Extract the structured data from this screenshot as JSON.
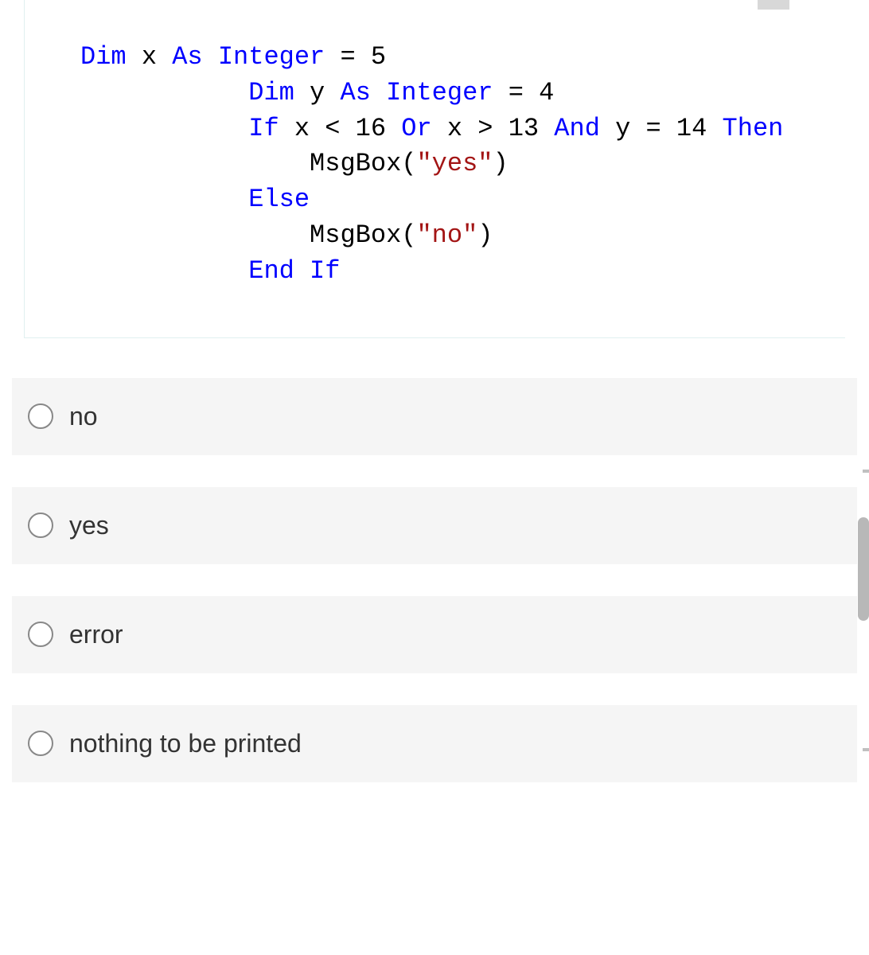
{
  "code": {
    "line1_kw1": "Dim",
    "line1_txt1": " x ",
    "line1_kw2": "As Integer",
    "line1_txt2": " = 5",
    "indent": "           ",
    "line2_kw1": "Dim",
    "line2_txt1": " y ",
    "line2_kw2": "As Integer",
    "line2_txt2": " = 4",
    "line3_kw1": "If",
    "line3_txt1": " x < 16 ",
    "line3_kw2": "Or",
    "line3_txt2": " x > 13 ",
    "line3_kw3": "And",
    "line3_txt3": " y = 14 ",
    "line3_kw4": "Then",
    "line4_txt1": "    MsgBox(",
    "line4_str": "\"yes\"",
    "line4_txt2": ")",
    "line5_kw": "Else",
    "line6_txt1": "    MsgBox(",
    "line6_str": "\"no\"",
    "line6_txt2": ")",
    "line7_kw": "End If"
  },
  "options": [
    {
      "label": "no"
    },
    {
      "label": "yes"
    },
    {
      "label": "error"
    },
    {
      "label": "nothing to be printed"
    }
  ]
}
